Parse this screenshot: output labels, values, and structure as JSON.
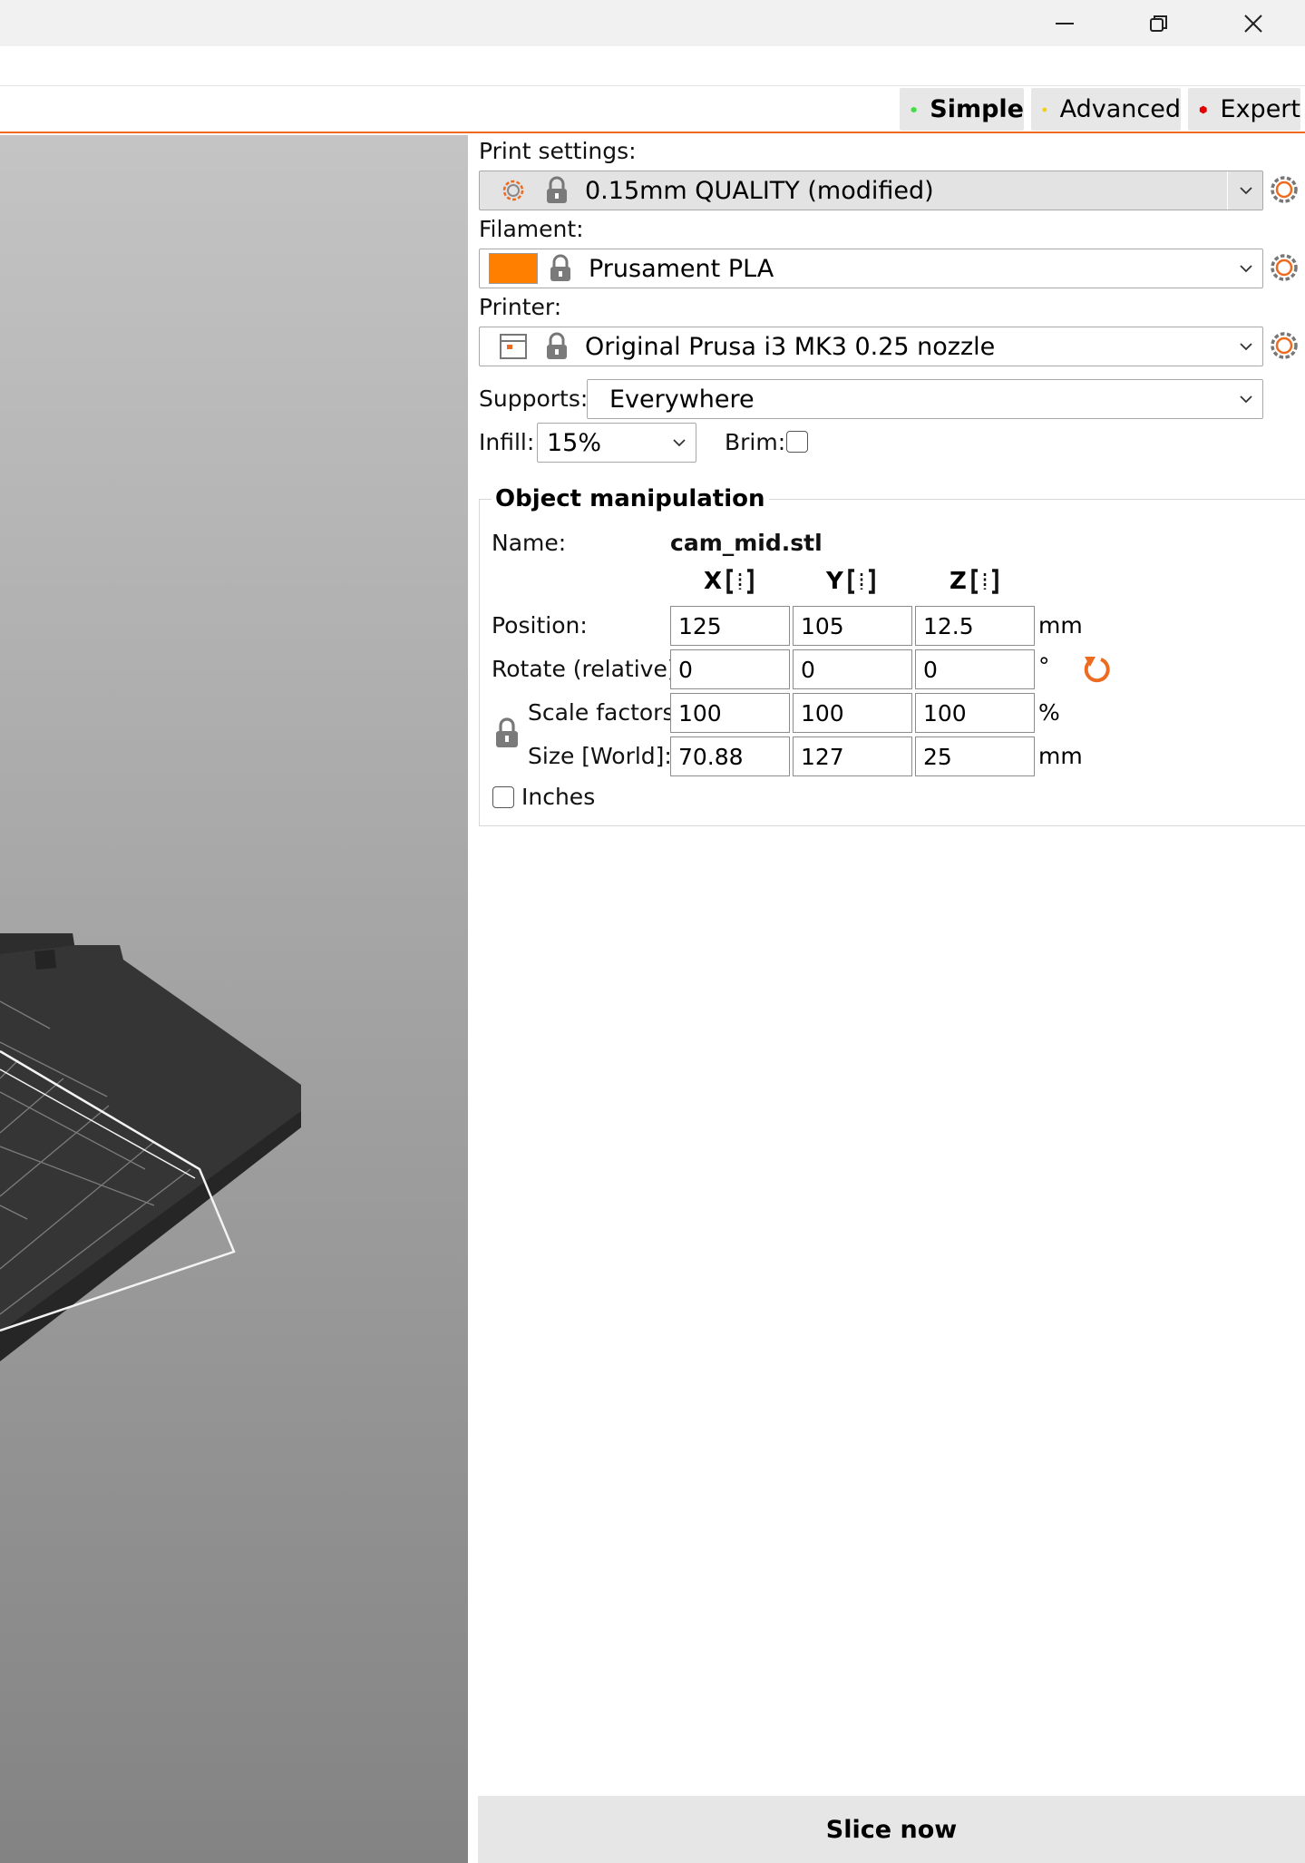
{
  "window": {
    "minimize_icon": "minimize-icon",
    "restore_icon": "restore-icon",
    "close_icon": "close-icon"
  },
  "modes": [
    {
      "label": "Simple",
      "color": "#3fe03f",
      "active": true
    },
    {
      "label": "Advanced",
      "color": "#f5d000",
      "active": false
    },
    {
      "label": "Expert",
      "color": "#e30000",
      "active": false
    }
  ],
  "print_settings": {
    "label": "Print settings:",
    "value": "0.15mm QUALITY (modified)"
  },
  "filament": {
    "label": "Filament:",
    "value": "Prusament PLA",
    "color": "#ff8000"
  },
  "printer": {
    "label": "Printer:",
    "value": "Original Prusa i3 MK3 0.25 nozzle"
  },
  "supports": {
    "label": "Supports:",
    "value": "Everywhere"
  },
  "infill": {
    "label": "Infill:",
    "value": "15%"
  },
  "brim": {
    "label": "Brim:",
    "checked": false
  },
  "object_manipulation": {
    "title": "Object manipulation",
    "name_label": "Name:",
    "name_value": "cam_mid.stl",
    "axes": [
      "X",
      "Y",
      "Z"
    ],
    "position": {
      "label": "Position:",
      "values": [
        "125",
        "105",
        "12.5"
      ],
      "unit": "mm"
    },
    "rotate": {
      "label": "Rotate (relative):",
      "values": [
        "0",
        "0",
        "0"
      ],
      "unit": "°"
    },
    "scale": {
      "label": "Scale factors:",
      "values": [
        "100",
        "100",
        "100"
      ],
      "unit": "%"
    },
    "size": {
      "label": "Size [World]:",
      "values": [
        "70.88",
        "127",
        "25"
      ],
      "unit": "mm"
    },
    "inches": {
      "label": "Inches",
      "checked": false
    }
  },
  "slice_button": {
    "label": "Slice now"
  },
  "accent_color": "#ed6b21"
}
